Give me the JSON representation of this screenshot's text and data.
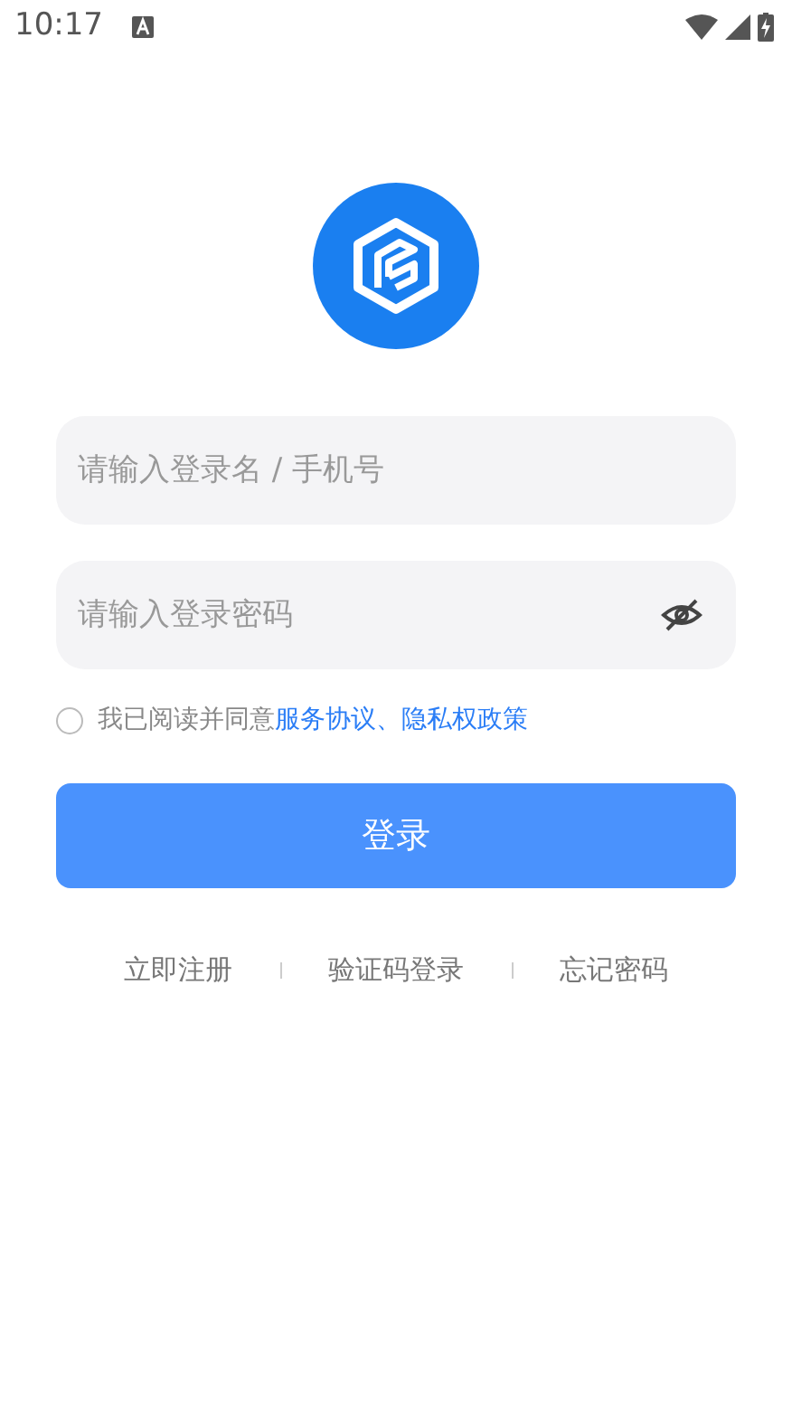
{
  "status_bar": {
    "time": "10:17"
  },
  "fields": [
    {
      "kind": "text",
      "placeholder": "请输入登录名 / 手机号"
    },
    {
      "kind": "password",
      "placeholder": "请输入登录密码",
      "visible": false
    }
  ],
  "agreement": {
    "checked": false,
    "text": "我已阅读并同意",
    "link": "服务协议、隐私权政策"
  },
  "login_button": "登录",
  "links": [
    "立即注册",
    "验证码登录",
    "忘记密码"
  ]
}
